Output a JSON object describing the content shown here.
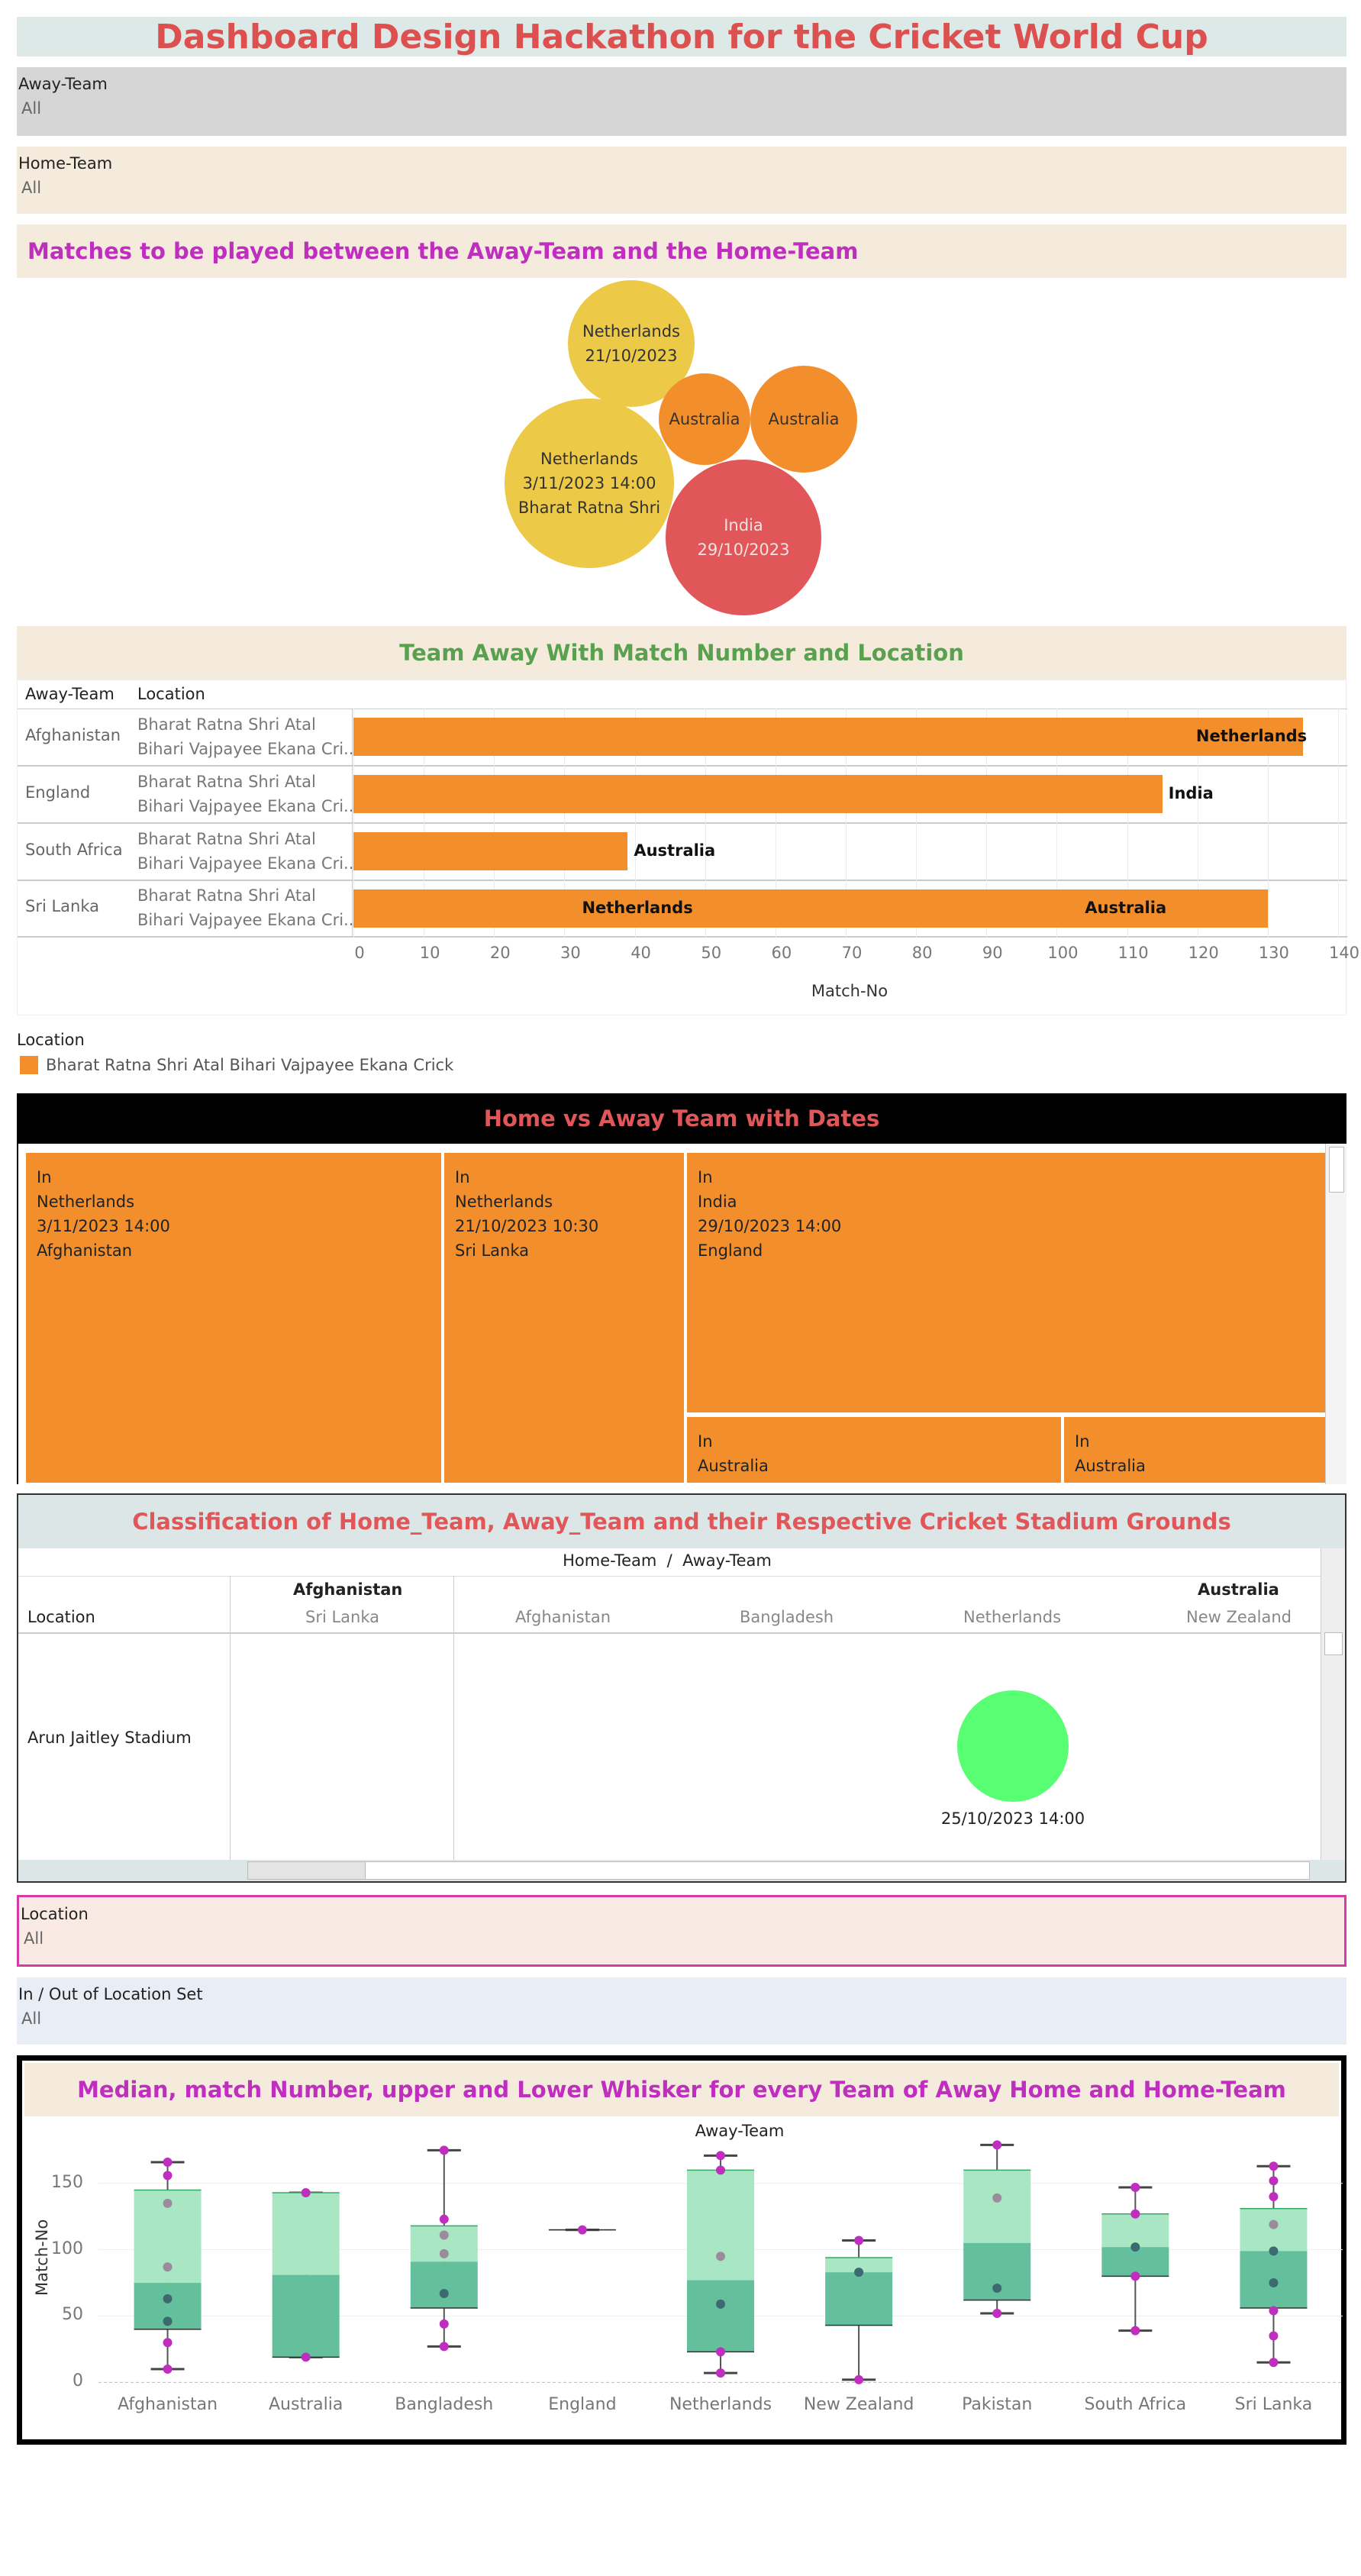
{
  "title": "Dashboard Design Hackathon for the Cricket World Cup",
  "filters": {
    "away_team": {
      "label": "Away-Team",
      "value": "All"
    },
    "home_team": {
      "label": "Home-Team",
      "value": "All"
    },
    "location": {
      "label": "Location",
      "value": "All"
    },
    "in_out_location": {
      "label": "In / Out of Location Set",
      "value": "All"
    }
  },
  "colors": {
    "orange": "#f28e2b",
    "yellow": "#edc948",
    "red": "#e15759",
    "green_bubble": "#59ff72",
    "title_red": "#dc5050",
    "magenta": "#c02ec0",
    "green_title": "#59a14f"
  },
  "bubbles": {
    "heading": "Matches to be played between the Away-Team and the Home-Team",
    "items": [
      {
        "lines": [
          "Netherlands",
          "21/10/2023"
        ],
        "color": "#edc948"
      },
      {
        "lines": [
          "Australia"
        ],
        "color": "#f28e2b"
      },
      {
        "lines": [
          "Australia"
        ],
        "color": "#f28e2b"
      },
      {
        "lines": [
          "Netherlands",
          "3/11/2023 14:00",
          "Bharat Ratna Shri"
        ],
        "color": "#edc948"
      },
      {
        "lines": [
          "India",
          "29/10/2023"
        ],
        "color": "#e15759"
      }
    ]
  },
  "bar_chart": {
    "heading": "Team Away With Match Number and Location",
    "col_headers": [
      "Away-Team",
      "Location"
    ],
    "xlabel": "Match-No",
    "rows": [
      {
        "team": "Afghanistan",
        "loc1": "Bharat Ratna Shri Atal",
        "loc2": "Bihari Vajpayee Ekana Cri..",
        "label": "Netherlands"
      },
      {
        "team": "England",
        "loc1": "Bharat Ratna Shri Atal",
        "loc2": "Bihari Vajpayee Ekana Cri..",
        "label": "India"
      },
      {
        "team": "South Africa",
        "loc1": "Bharat Ratna Shri Atal",
        "loc2": "Bihari Vajpayee Ekana Cri..",
        "label": "Australia"
      },
      {
        "team": "Sri Lanka",
        "loc1": "Bharat Ratna Shri Atal",
        "loc2": "Bihari Vajpayee Ekana Cri..",
        "label": "Netherlands",
        "label2": "Australia"
      }
    ],
    "legend_title": "Location",
    "legend_item": "Bharat Ratna Shri Atal Bihari Vajpayee Ekana Crick"
  },
  "chart_data": [
    {
      "type": "bar",
      "orientation": "horizontal",
      "categories": [
        "Afghanistan",
        "England",
        "South Africa",
        "Sri Lanka"
      ],
      "values": [
        135,
        115,
        39,
        130
      ],
      "xlim": [
        0,
        140
      ],
      "xticks": [
        0,
        10,
        20,
        30,
        40,
        50,
        60,
        70,
        80,
        90,
        100,
        110,
        120,
        130,
        140
      ],
      "xlabel": "Match-No",
      "legend": [
        "Bharat Ratna Shri Atal Bihari Vajpayee Ekana Crick"
      ]
    },
    {
      "type": "box",
      "title": "Away-Team",
      "ylabel": "Match-No",
      "yticks": [
        0,
        50,
        100,
        150
      ],
      "ylim": [
        -5,
        185
      ],
      "categories": [
        "Afghanistan",
        "Australia",
        "Bangladesh",
        "England",
        "Netherlands",
        "New Zealand",
        "Pakistan",
        "South Africa",
        "Sri Lanka"
      ],
      "boxes": [
        {
          "min": 10,
          "q1": 40,
          "median": 75,
          "q3": 145,
          "max": 166,
          "points": [
            166,
            156,
            135,
            87,
            63,
            46,
            30,
            10
          ]
        },
        {
          "min": 19,
          "q1": 19,
          "median": 81,
          "q3": 143,
          "max": 143,
          "points": [
            143,
            19
          ]
        },
        {
          "min": 27,
          "q1": 56,
          "median": 91,
          "q3": 118,
          "max": 175,
          "points": [
            175,
            123,
            111,
            97,
            67,
            44,
            27
          ]
        },
        {
          "min": 115,
          "q1": 115,
          "median": 115,
          "q3": 115,
          "max": 115,
          "points": [
            115
          ]
        },
        {
          "min": 7,
          "q1": 23,
          "median": 77,
          "q3": 160,
          "max": 171,
          "points": [
            171,
            160,
            95,
            59,
            23,
            7
          ]
        },
        {
          "min": 2,
          "q1": 43,
          "median": 83,
          "q3": 94,
          "max": 107,
          "points": [
            107,
            83,
            2
          ]
        },
        {
          "min": 52,
          "q1": 62,
          "median": 105,
          "q3": 160,
          "max": 179,
          "points": [
            179,
            139,
            71,
            52
          ]
        },
        {
          "min": 39,
          "q1": 80,
          "median": 102,
          "q3": 127,
          "max": 147,
          "points": [
            147,
            127,
            102,
            80,
            39
          ]
        },
        {
          "min": 15,
          "q1": 56,
          "median": 99,
          "q3": 131,
          "max": 163,
          "points": [
            163,
            152,
            140,
            119,
            99,
            75,
            54,
            35,
            15
          ]
        }
      ]
    }
  ],
  "treemap": {
    "heading": "Home vs Away Team with Dates",
    "tiles": [
      {
        "lines": [
          "In",
          "Netherlands",
          "3/11/2023 14:00",
          "Afghanistan"
        ]
      },
      {
        "lines": [
          "In",
          "Netherlands",
          "21/10/2023 10:30",
          "Sri Lanka"
        ]
      },
      {
        "lines": [
          "In",
          "India",
          "29/10/2023 14:00",
          "England"
        ]
      },
      {
        "lines": [
          "In",
          "Australia"
        ]
      },
      {
        "lines": [
          "In",
          "Australia"
        ]
      }
    ]
  },
  "classification": {
    "heading": "Classification of Home_Team, Away_Team and their Respective Cricket Stadium Grounds",
    "top_header": "Home-Team  /  Away-Team",
    "location_header": "Location",
    "groups": [
      {
        "home": "Afghanistan",
        "aways": [
          "Sri Lanka"
        ]
      },
      {
        "home": "Australia",
        "aways": [
          "Afghanistan",
          "Bangladesh",
          "Netherlands",
          "New Zealand"
        ]
      }
    ],
    "row_label": "Arun Jaitley Stadium",
    "point_label": "25/10/2023 14:00"
  },
  "boxplot": {
    "heading": "Median,  match Number, upper and Lower Whisker for every Team of Away Home and Home-Team",
    "title": "Away-Team",
    "ylabel": "Match-No",
    "yticks": [
      "0",
      "50",
      "100",
      "150"
    ]
  }
}
